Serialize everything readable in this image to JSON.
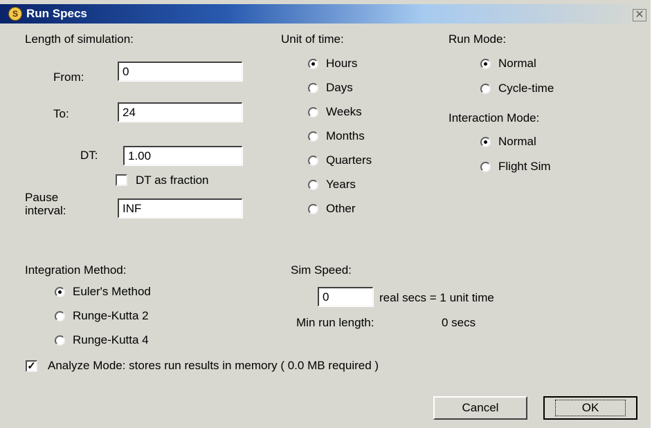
{
  "window": {
    "title": "Run Specs",
    "close_glyph": "✕",
    "app_icon": "S"
  },
  "length": {
    "heading": "Length of simulation:",
    "from_label": "From:",
    "from_value": "0",
    "to_label": "To:",
    "to_value": "24",
    "dt_label": "DT:",
    "dt_value": "1.00",
    "dt_fraction_label": "DT as fraction",
    "dt_fraction_checked": false,
    "pause_label_1": "Pause",
    "pause_label_2": "interval:",
    "pause_value": "INF"
  },
  "unit_of_time": {
    "heading": "Unit of time:",
    "options": [
      "Hours",
      "Days",
      "Weeks",
      "Months",
      "Quarters",
      "Years",
      "Other"
    ],
    "selected": "Hours"
  },
  "run_mode": {
    "heading": "Run Mode:",
    "options": [
      "Normal",
      "Cycle-time"
    ],
    "selected": "Normal"
  },
  "interaction_mode": {
    "heading": "Interaction Mode:",
    "options": [
      "Normal",
      "Flight Sim"
    ],
    "selected": "Normal"
  },
  "integration": {
    "heading": "Integration Method:",
    "options": [
      "Euler's Method",
      "Runge-Kutta 2",
      "Runge-Kutta 4"
    ],
    "selected": "Euler's Method"
  },
  "sim_speed": {
    "heading": "Sim Speed:",
    "value": "0",
    "suffix": "real secs = 1 unit time",
    "min_label": "Min run length:",
    "min_value": "0 secs"
  },
  "analyze": {
    "label": "Analyze Mode: stores run results in memory ( 0.0 MB required )",
    "checked": true
  },
  "buttons": {
    "cancel": "Cancel",
    "ok": "OK"
  }
}
